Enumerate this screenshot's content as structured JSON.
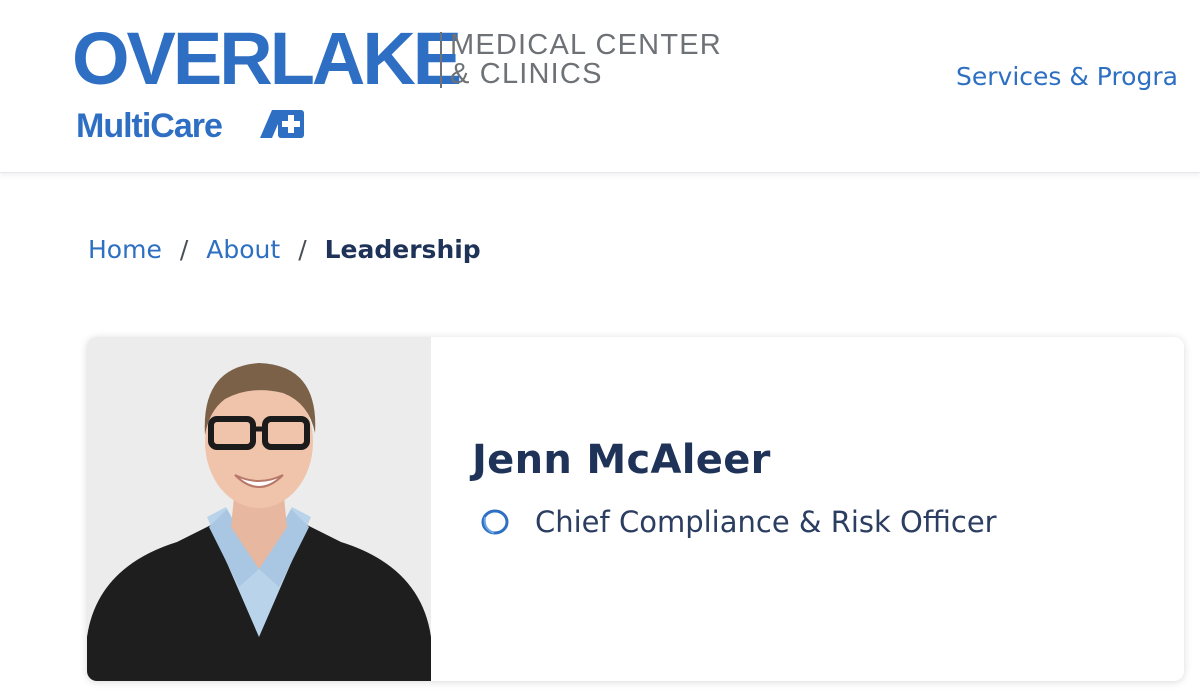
{
  "header": {
    "logo": {
      "name": "OVERLAKE",
      "tagline_line1": "MEDICAL CENTER",
      "tagline_line2": "& CLINICS",
      "partner": "MultiCare"
    },
    "nav": {
      "services_label": "Services & Progra"
    }
  },
  "breadcrumb": {
    "home": "Home",
    "separator": "/",
    "about": "About",
    "current": "Leadership"
  },
  "profile": {
    "name": "Jenn McAleer",
    "title": "Chief Compliance & Risk Officer",
    "title_icon": "overlake-ring-icon",
    "photo": "portrait-photo"
  },
  "colors": {
    "brand_blue": "#2e6fc4",
    "link_blue": "#2d6fc1",
    "navy": "#1f3257",
    "gray_text": "#6e7176"
  }
}
